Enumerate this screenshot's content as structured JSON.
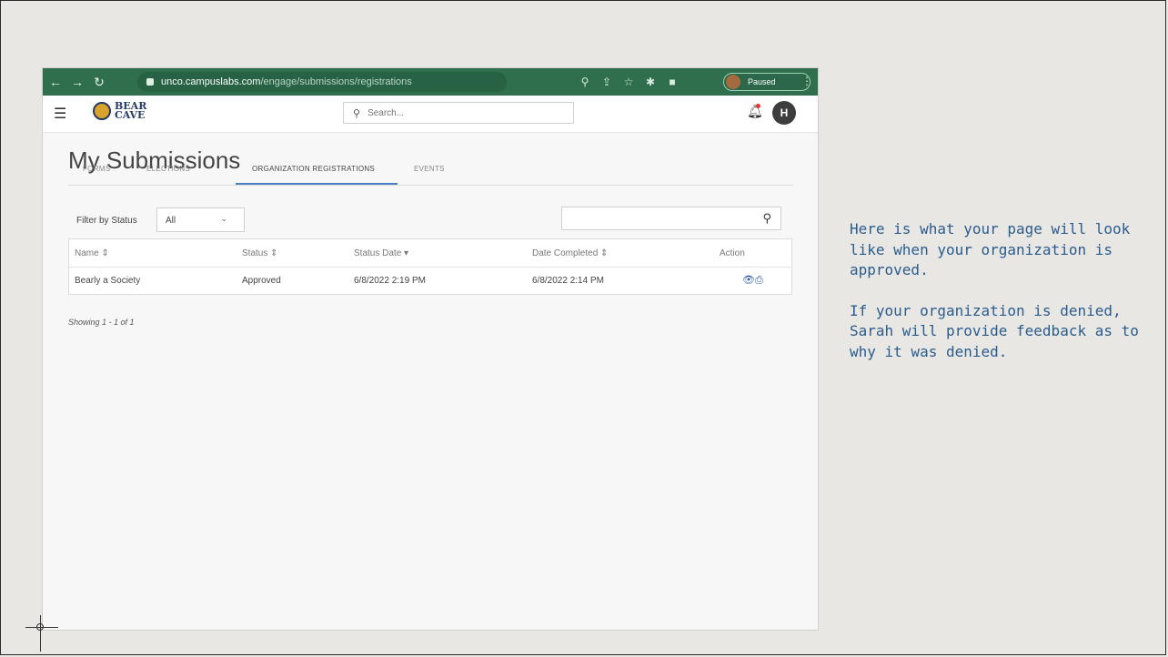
{
  "browser": {
    "url_host": "unco.campuslabs.com",
    "url_path": "/engage/submissions/registrations",
    "profile_status": "Paused"
  },
  "app": {
    "logo_line1": "BEAR",
    "logo_line2": "CAVE",
    "search_placeholder": "Search...",
    "avatar_initial": "H"
  },
  "page": {
    "title": "My Submissions",
    "tabs": [
      {
        "label": "FORMS"
      },
      {
        "label": "ELECTIONS"
      },
      {
        "label": "ORGANIZATION REGISTRATIONS"
      },
      {
        "label": "EVENTS"
      }
    ],
    "active_tab": "ORGANIZATION REGISTRATIONS",
    "filter_label": "Filter by Status",
    "filter_value": "All",
    "table": {
      "columns": [
        "Name ⇕",
        "Status ⇕",
        "Status Date ▾",
        "Date Completed ⇕",
        "Action"
      ],
      "rows": [
        {
          "name": "Bearly a Society",
          "status": "Approved",
          "status_date": "6/8/2022 2:19 PM",
          "date_completed": "6/8/2022 2:14 PM"
        }
      ]
    },
    "showing": "Showing 1 - 1 of 1"
  },
  "note": {
    "para1": "Here is what your page will look like when your organization is approved.",
    "para2": "If your organization is denied, Sarah will provide feedback as to why it was denied."
  },
  "colors": {
    "browser_bar": "#2f6f4e",
    "tab_accent": "#4d7fc3",
    "action_icons": "#2a5ca8",
    "note_text": "#2a5c8e"
  }
}
